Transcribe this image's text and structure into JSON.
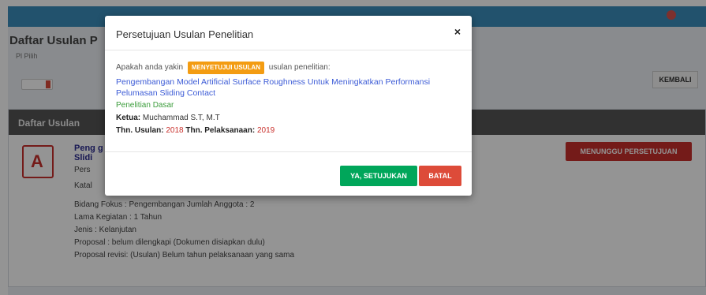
{
  "background": {
    "page_title": "Daftar Usulan P",
    "subtitle": "Pl               Pilih",
    "kembali_label": "KEMBALI",
    "panel_header": "Daftar Usulan",
    "item": {
      "title_line1": "Peng                                                                                  g Pelumasan",
      "title_line2": "Slidi",
      "lines": [
        "Pers",
        "Katal",
        "Bidang Fokus : Pengembangan Jumlah Anggota : 2",
        "Lama Kegiatan : 1 Tahun",
        "Jenis : Kelanjutan",
        "Proposal : belum dilengkapi (Dokumen disiapkan dulu)",
        "Proposal revisi: (Usulan) Belum tahun pelaksanaan yang sama"
      ]
    },
    "persetujuan_label": "MENUNGGU PERSETUJUAN"
  },
  "modal": {
    "title": "Persetujuan Usulan Penelitian",
    "close_glyph": "×",
    "question_prefix": "Apakah anda yakin",
    "badge": "MENYETUJUI USULAN",
    "question_suffix": "usulan penelitian:",
    "research_title": "Pengembangan Model Artificial Surface Roughness Untuk Meningkatkan Performansi Pelumasan Sliding Contact",
    "category": "Penelitian Dasar",
    "ketua_label": "Ketua:",
    "ketua_value": "Muchammad S.T, M.T",
    "thn_usulan_label": "Thn. Usulan:",
    "thn_usulan_value": "2018",
    "thn_pelaksanaan_label": "Thn. Pelaksanaan:",
    "thn_pelaksanaan_value": "2019",
    "agree_label": "YA, SETUJUKAN",
    "cancel_label": "BATAL"
  },
  "colors": {
    "topbar": "#3c8dbc",
    "badge": "#f39c12",
    "agree": "#00a65a",
    "cancel": "#dd4b39",
    "link": "#3c5bd6"
  }
}
